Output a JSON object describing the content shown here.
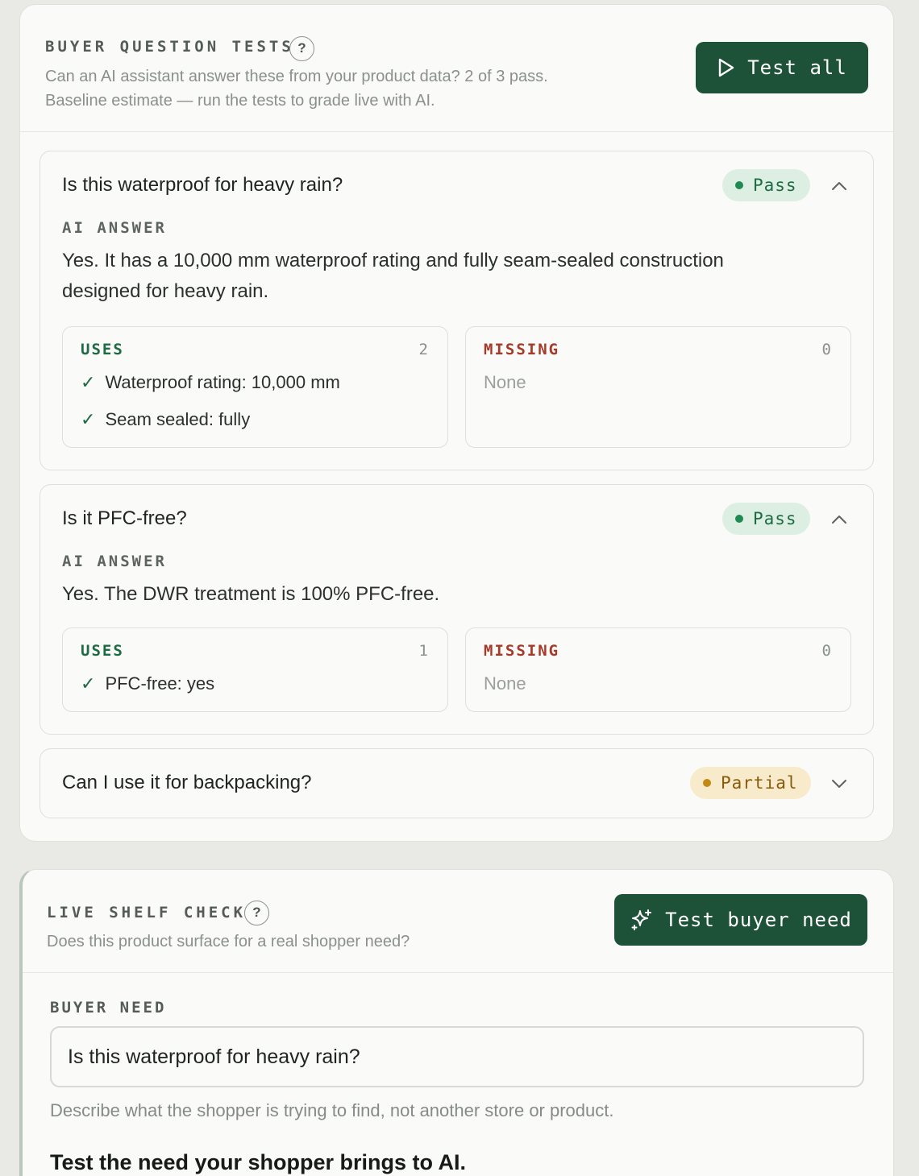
{
  "buyer_tests": {
    "title": "BUYER QUESTION TESTS",
    "help_glyph": "?",
    "description_line1": "Can an AI assistant answer these from your product data? 2 of 3 pass.",
    "description_line2": "Baseline estimate — run the tests to grade live with AI.",
    "test_all_label": "Test all",
    "questions": [
      {
        "question": "Is this waterproof for heavy rain?",
        "status": "Pass",
        "expanded": true,
        "ai_answer_label": "AI ANSWER",
        "ai_answer": "Yes. It has a 10,000 mm waterproof rating and fully seam-sealed construction designed for heavy rain.",
        "uses_label": "USES",
        "uses_count": "2",
        "uses": [
          "Waterproof rating: 10,000 mm",
          "Seam sealed: fully"
        ],
        "missing_label": "MISSING",
        "missing_count": "0",
        "missing_text": "None"
      },
      {
        "question": "Is it PFC-free?",
        "status": "Pass",
        "expanded": true,
        "ai_answer_label": "AI ANSWER",
        "ai_answer": "Yes. The DWR treatment is 100% PFC-free.",
        "uses_label": "USES",
        "uses_count": "1",
        "uses": [
          "PFC-free: yes"
        ],
        "missing_label": "MISSING",
        "missing_count": "0",
        "missing_text": "None"
      },
      {
        "question": "Can I use it for backpacking?",
        "status": "Partial",
        "expanded": false
      }
    ],
    "check_glyph": "✓",
    "colors": {
      "pass": "#1f8a52",
      "partial": "#c28a12",
      "primary": "#1d5238",
      "missing": "#a63a2a"
    }
  },
  "shelf_check": {
    "title": "LIVE SHELF CHECK",
    "help_glyph": "?",
    "description": "Does this product surface for a real shopper need?",
    "button_label": "Test buyer need",
    "buyer_need_label": "BUYER NEED",
    "buyer_need_value": "Is this waterproof for heavy rain?",
    "hint": "Describe what the shopper is trying to find, not another store or product.",
    "cta_heading": "Test the need your shopper brings to AI."
  },
  "icons": {
    "test_all": "play-icon",
    "test_buyer_need": "sparkle-icon",
    "expanded": "chevron-up-icon",
    "collapsed": "chevron-down-icon"
  }
}
